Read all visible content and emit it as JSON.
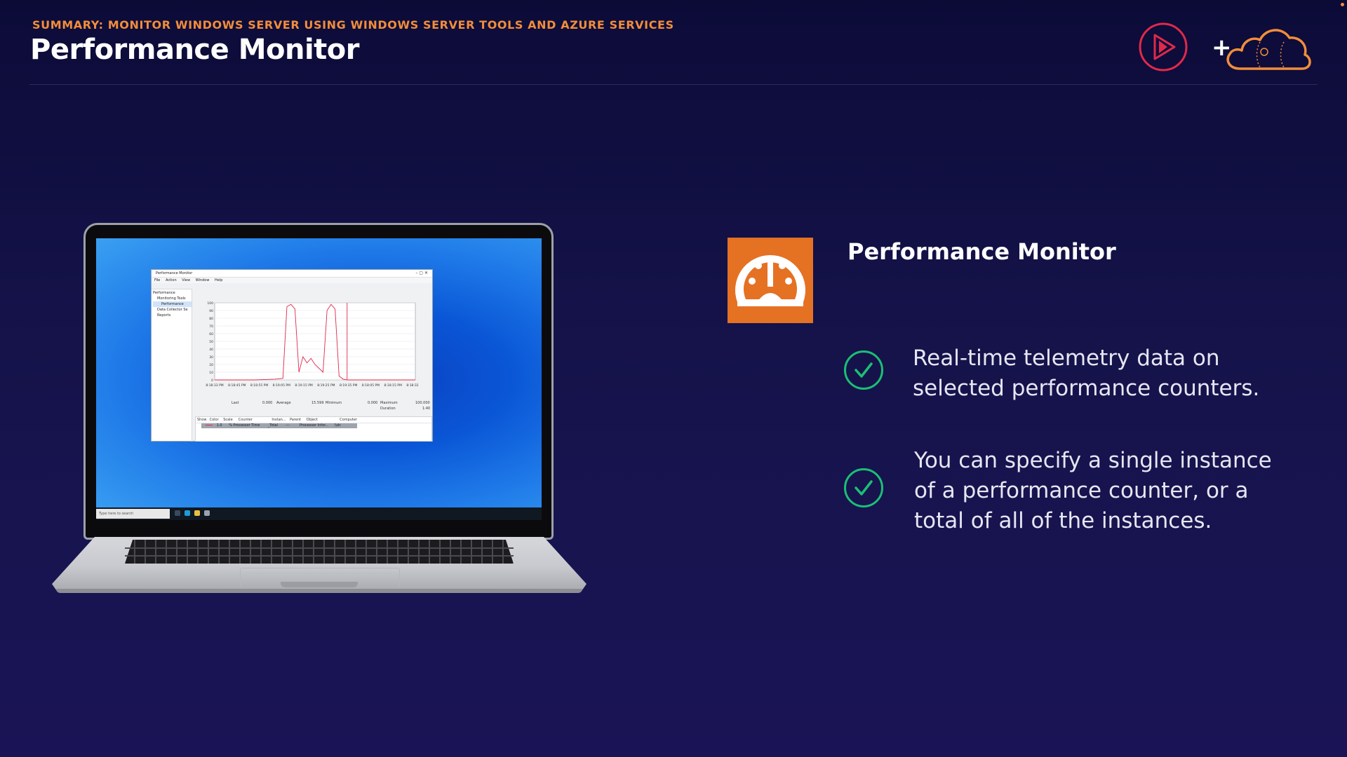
{
  "header": {
    "eyebrow": "SUMMARY: MONITOR WINDOWS SERVER USING WINDOWS SERVER TOOLS AND AZURE SERVICES",
    "title": "Performance Monitor",
    "brand_plus": "+"
  },
  "colors": {
    "accent_orange": "#f28d3a",
    "icon_bg": "#e57123",
    "check_green": "#1bbf75",
    "play_red": "#e0294a"
  },
  "icons": {
    "play": "play-logo-icon",
    "cloud": "cloud-logo-icon",
    "gauge": "gauge-icon",
    "check": "check-circle-icon"
  },
  "content": {
    "section_title": "Performance Monitor",
    "bullets": [
      {
        "line1": "Real-time telemetry data on",
        "line2": "selected performance counters.",
        "line3": ""
      },
      {
        "line1": "You can specify a single instance",
        "line2": "of a performance counter, or a",
        "line3": "total of all of the instances."
      }
    ]
  },
  "perfmon": {
    "window_title": "Performance Monitor",
    "menu": [
      "File",
      "Action",
      "View",
      "Window",
      "Help"
    ],
    "tree": [
      "Performance",
      "Monitoring Tools",
      "Performance",
      "Data Collector Se",
      "Reports"
    ],
    "stats": {
      "last_label": "Last",
      "last_value": "0.000",
      "average_label": "Average",
      "average_value": "15.599",
      "minimum_label": "Minimum",
      "minimum_value": "0.000",
      "maximum_label": "Maximum",
      "maximum_value": "100.000",
      "duration_label": "Duration",
      "duration_value": "1:40"
    },
    "table_headers": [
      "Show",
      "Color",
      "Scale",
      "Counter",
      "Instan...",
      "Parent",
      "Object",
      "Computer"
    ],
    "table_row": [
      "1.0",
      "% Processor Time",
      "_Total",
      "---",
      "Processor Infor...",
      "\\\\dc"
    ],
    "taskbar_search": "Type here to search"
  },
  "chart_data": {
    "type": "line",
    "title": "",
    "xlabel": "",
    "ylabel": "",
    "ylim": [
      0,
      100
    ],
    "y_ticks": [
      0,
      10,
      20,
      30,
      40,
      50,
      60,
      70,
      80,
      90,
      100
    ],
    "x_tick_labels": [
      "8:18:33 PM",
      "8:18:45 PM",
      "8:18:55 PM",
      "8:19:05 PM",
      "8:19:15 PM",
      "8:19:25 PM",
      "8:19:35 PM",
      "8:18:05 PM",
      "8:18:15 PM",
      "8:18:32 PM"
    ],
    "series": [
      {
        "name": "",
        "x": [
          0,
          10,
          20,
          30,
          34,
          36,
          38,
          40,
          42,
          44,
          46,
          48,
          50,
          52,
          54,
          56,
          58,
          60,
          62,
          64,
          66,
          100
        ],
        "values": [
          0,
          0,
          0,
          1,
          2,
          95,
          98,
          92,
          10,
          30,
          22,
          28,
          20,
          15,
          10,
          90,
          98,
          92,
          5,
          1,
          0,
          0
        ]
      }
    ]
  }
}
